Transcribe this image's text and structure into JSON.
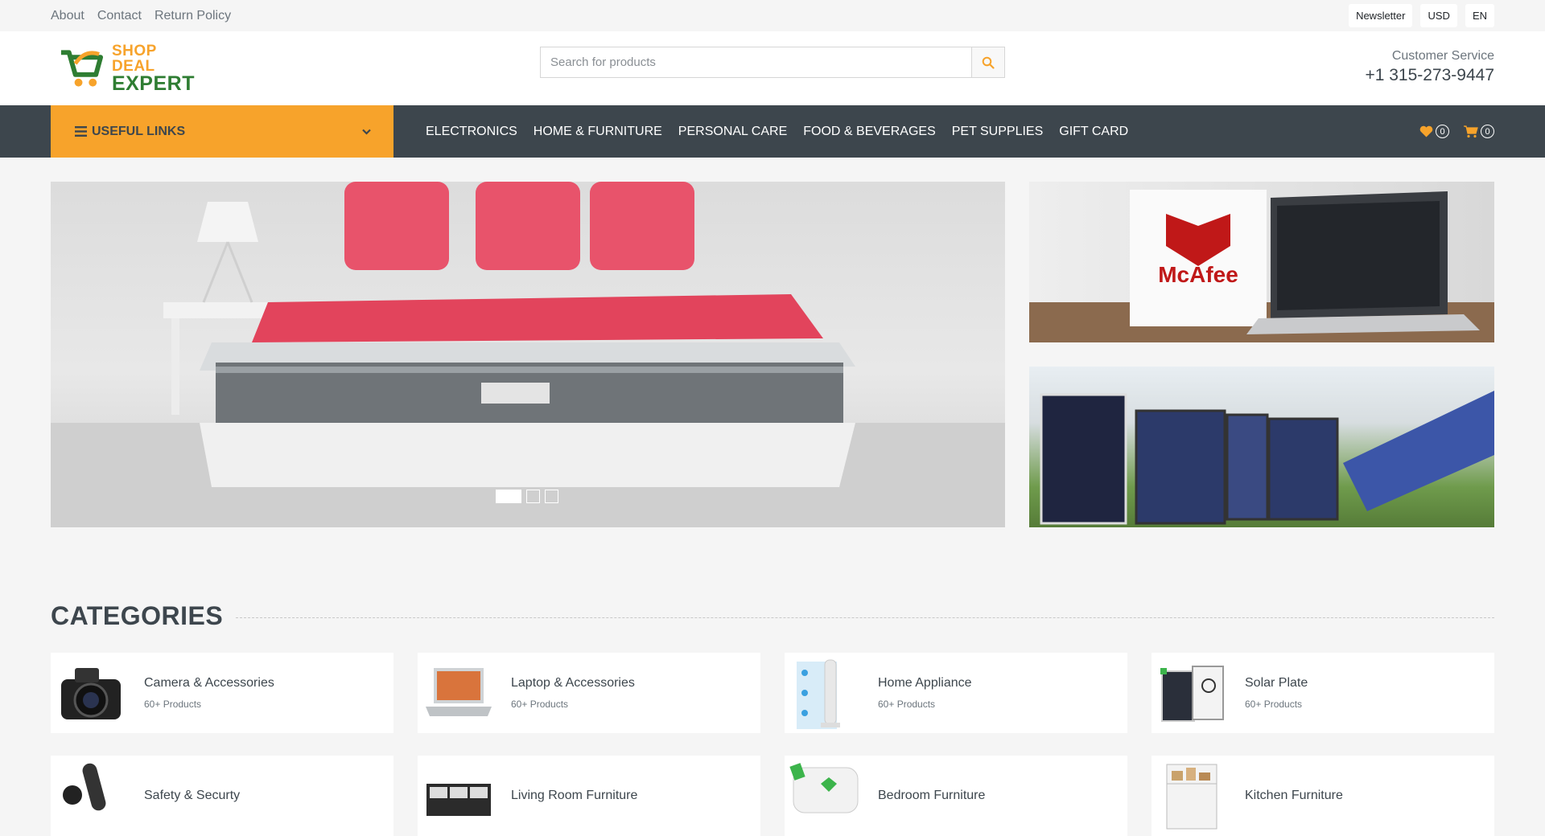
{
  "topbar": {
    "links": [
      "About",
      "Contact",
      "Return Policy"
    ],
    "pills": [
      "Newsletter",
      "USD",
      "EN"
    ]
  },
  "header": {
    "logo_line1": "SHOP DEAL",
    "logo_line2": "EXPERT",
    "search_placeholder": "Search for products",
    "customer_service_label": "Customer Service",
    "phone": "+1 315-273-9447"
  },
  "nav": {
    "useful_links": "USEFUL LINKS",
    "items": [
      "ELECTRONICS",
      "HOME & FURNITURE",
      "PERSONAL CARE",
      "FOOD & BEVERAGES",
      "PET SUPPLIES",
      "GIFT CARD"
    ],
    "wishlist_count": "0",
    "cart_count": "0"
  },
  "banners": {
    "side_brand": "McAfee"
  },
  "categories": {
    "title": "CATEGORIES",
    "items": [
      {
        "name": "Camera & Accessories",
        "count": "60+ Products",
        "icon": "camera-icon"
      },
      {
        "name": "Laptop & Accessories",
        "count": "60+ Products",
        "icon": "laptop-icon"
      },
      {
        "name": "Home Appliance",
        "count": "60+ Products",
        "icon": "fan-icon"
      },
      {
        "name": "Solar Plate",
        "count": "60+ Products",
        "icon": "solar-panel-icon"
      },
      {
        "name": "Safety & Securty",
        "count": "",
        "icon": "security-icon"
      },
      {
        "name": "Living Room Furniture",
        "count": "",
        "icon": "shelf-icon"
      },
      {
        "name": "Bedroom Furniture",
        "count": "",
        "icon": "pillow-icon"
      },
      {
        "name": "Kitchen Furniture",
        "count": "",
        "icon": "cabinet-icon"
      }
    ]
  },
  "colors": {
    "accent": "#f7a32b",
    "dark": "#3d464d",
    "logo_green": "#2e7d32"
  }
}
